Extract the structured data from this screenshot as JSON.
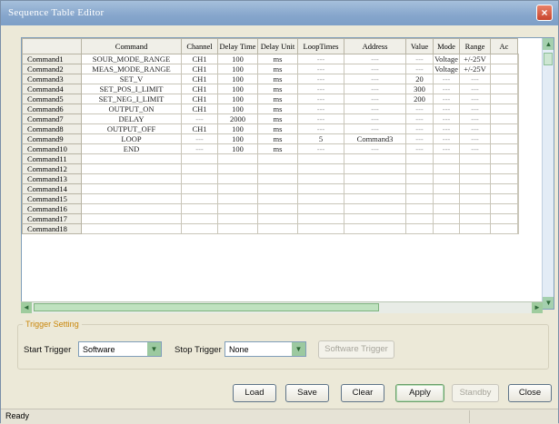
{
  "window": {
    "title": "Sequence Table Editor",
    "close_glyph": "×"
  },
  "table": {
    "columns": [
      "Command",
      "Channel",
      "Delay Time",
      "Delay Unit",
      "LoopTimes",
      "Address",
      "Value",
      "Mode",
      "Range",
      "Ac"
    ],
    "rows": [
      {
        "name": "Command1",
        "cells": [
          "SOUR_MODE_RANGE",
          "CH1",
          "100",
          "ms",
          "---",
          "---",
          "---",
          "Voltage",
          "+/-25V",
          ""
        ]
      },
      {
        "name": "Command2",
        "cells": [
          "MEAS_MODE_RANGE",
          "CH1",
          "100",
          "ms",
          "---",
          "---",
          "---",
          "Voltage",
          "+/-25V",
          ""
        ]
      },
      {
        "name": "Command3",
        "cells": [
          "SET_V",
          "CH1",
          "100",
          "ms",
          "---",
          "---",
          "20",
          "---",
          "---",
          ""
        ]
      },
      {
        "name": "Command4",
        "cells": [
          "SET_POS_I_LIMIT",
          "CH1",
          "100",
          "ms",
          "---",
          "---",
          "300",
          "---",
          "---",
          ""
        ]
      },
      {
        "name": "Command5",
        "cells": [
          "SET_NEG_I_LIMIT",
          "CH1",
          "100",
          "ms",
          "---",
          "---",
          "200",
          "---",
          "---",
          ""
        ]
      },
      {
        "name": "Command6",
        "cells": [
          "OUTPUT_ON",
          "CH1",
          "100",
          "ms",
          "---",
          "---",
          "---",
          "---",
          "---",
          ""
        ]
      },
      {
        "name": "Command7",
        "cells": [
          "DELAY",
          "---",
          "2000",
          "ms",
          "---",
          "---",
          "---",
          "---",
          "---",
          ""
        ]
      },
      {
        "name": "Command8",
        "cells": [
          "OUTPUT_OFF",
          "CH1",
          "100",
          "ms",
          "---",
          "---",
          "---",
          "---",
          "---",
          ""
        ]
      },
      {
        "name": "Command9",
        "cells": [
          "LOOP",
          "---",
          "100",
          "ms",
          "5",
          "Command3",
          "---",
          "---",
          "---",
          ""
        ]
      },
      {
        "name": "Command10",
        "cells": [
          "END",
          "---",
          "100",
          "ms",
          "---",
          "---",
          "---",
          "---",
          "---",
          ""
        ]
      },
      {
        "name": "Command11",
        "cells": [
          "",
          "",
          "",
          "",
          "",
          "",
          "",
          "",
          "",
          ""
        ]
      },
      {
        "name": "Command12",
        "cells": [
          "",
          "",
          "",
          "",
          "",
          "",
          "",
          "",
          "",
          ""
        ]
      },
      {
        "name": "Command13",
        "cells": [
          "",
          "",
          "",
          "",
          "",
          "",
          "",
          "",
          "",
          ""
        ]
      },
      {
        "name": "Command14",
        "cells": [
          "",
          "",
          "",
          "",
          "",
          "",
          "",
          "",
          "",
          ""
        ]
      },
      {
        "name": "Command15",
        "cells": [
          "",
          "",
          "",
          "",
          "",
          "",
          "",
          "",
          "",
          ""
        ]
      },
      {
        "name": "Command16",
        "cells": [
          "",
          "",
          "",
          "",
          "",
          "",
          "",
          "",
          "",
          ""
        ]
      },
      {
        "name": "Command17",
        "cells": [
          "",
          "",
          "",
          "",
          "",
          "",
          "",
          "",
          "",
          ""
        ]
      },
      {
        "name": "Command18",
        "cells": [
          "",
          "",
          "",
          "",
          "",
          "",
          "",
          "",
          "",
          ""
        ]
      }
    ]
  },
  "scroll": {
    "up": "▲",
    "down": "▼",
    "left": "◄",
    "right": "►"
  },
  "trigger": {
    "group_label": "Trigger Setting",
    "start_label": "Start Trigger",
    "start_value": "Software",
    "stop_label": "Stop Trigger",
    "stop_value": "None",
    "software_trigger": "Software Trigger",
    "dropdown_glyph": "▼"
  },
  "buttons": {
    "load": "Load",
    "save": "Save",
    "clear": "Clear",
    "apply": "Apply",
    "standby": "Standby",
    "close": "Close"
  },
  "status": {
    "text": "Ready"
  },
  "colors": {
    "accent": "#c9860a",
    "titlebar": "#86a6cc",
    "scroll": "#9fcc9e"
  }
}
